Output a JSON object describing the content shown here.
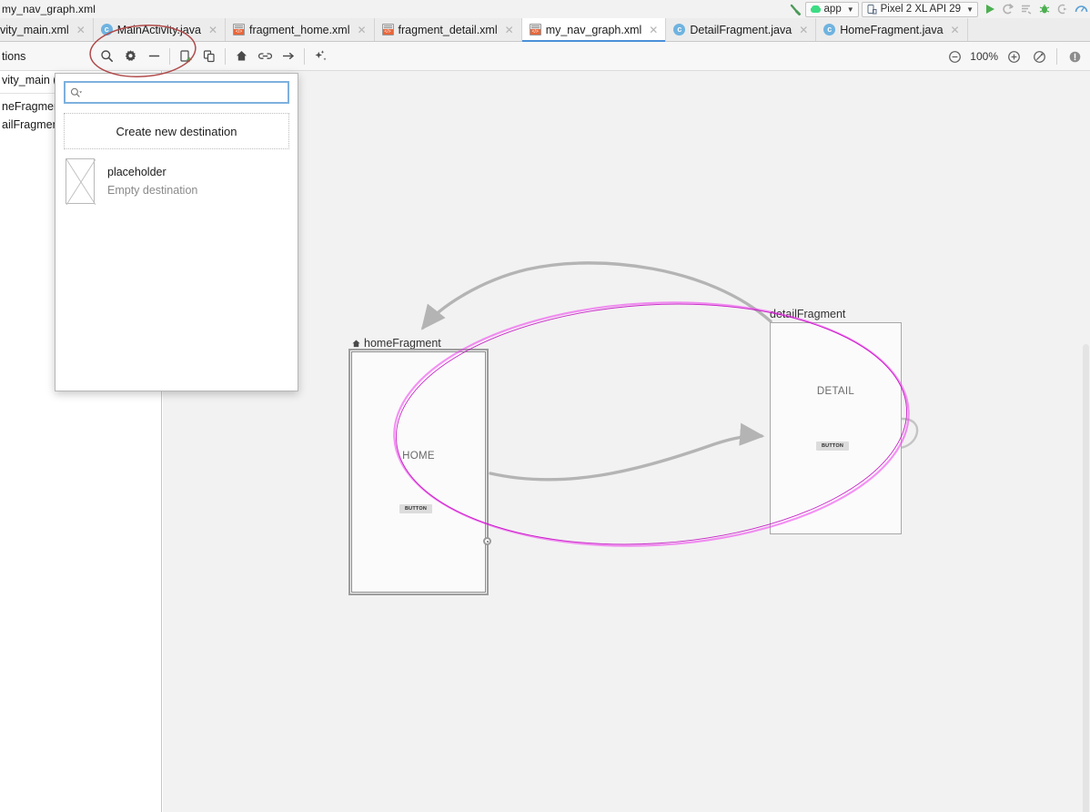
{
  "window": {
    "breadcrumb_title": "my_nav_graph.xml"
  },
  "run_toolbar": {
    "build_icon": "build-hammer-icon",
    "run_config": {
      "label": "app",
      "icon": "android-icon",
      "caret": "▼"
    },
    "device": {
      "label": "Pixel 2 XL API 29",
      "icon": "device-icon",
      "caret": "▼"
    },
    "actions": [
      {
        "name": "run-button",
        "icon": "play-icon",
        "color": "#4caf50"
      },
      {
        "name": "apply-changes-button",
        "icon": "apply-changes-icon",
        "color": "#b0b0b0"
      },
      {
        "name": "apply-code-changes-button",
        "icon": "apply-code-changes-icon",
        "color": "#b0b0b0"
      },
      {
        "name": "debug-button",
        "icon": "debug-bug-icon",
        "color": "#4caf50"
      },
      {
        "name": "attach-debugger-button",
        "icon": "attach-debugger-icon",
        "color": "#b0b0b0"
      },
      {
        "name": "profiler-button",
        "icon": "profiler-icon",
        "color": "#5a9fd4"
      }
    ]
  },
  "tabs": [
    {
      "label": "vity_main.xml",
      "icon": "xml-layout-icon",
      "active": false,
      "clipped": true
    },
    {
      "label": "MainActivity.java",
      "icon": "java-class-icon",
      "active": false
    },
    {
      "label": "fragment_home.xml",
      "icon": "xml-layout-icon",
      "active": false
    },
    {
      "label": "fragment_detail.xml",
      "icon": "xml-layout-icon",
      "active": false
    },
    {
      "label": "my_nav_graph.xml",
      "icon": "xml-layout-icon",
      "active": true
    },
    {
      "label": "DetailFragment.java",
      "icon": "java-class-icon",
      "active": false
    },
    {
      "label": "HomeFragment.java",
      "icon": "java-class-icon",
      "active": false
    }
  ],
  "nav_toolbar": {
    "left_label": "tions",
    "buttons": [
      {
        "name": "search-button",
        "icon": "search-icon",
        "tooltip": "Search"
      },
      {
        "name": "settings-button",
        "icon": "gear-icon",
        "tooltip": "Settings"
      },
      {
        "name": "remove-button",
        "icon": "minus-icon",
        "tooltip": "Remove"
      },
      {
        "name": "new-destination-button",
        "icon": "new-destination-icon",
        "tooltip": "New Destination"
      },
      {
        "name": "nested-graph-button",
        "icon": "nested-graph-icon",
        "tooltip": "Nested Graph"
      },
      {
        "name": "start-destination-button",
        "icon": "home-icon",
        "tooltip": "Assign start destination"
      },
      {
        "name": "action-button",
        "icon": "link-icon",
        "tooltip": "Add action"
      },
      {
        "name": "deeplink-button",
        "icon": "arrow-right-icon",
        "tooltip": "Add deep link"
      },
      {
        "name": "auto-arrange-button",
        "icon": "auto-arrange-icon",
        "tooltip": "Auto arrange"
      }
    ],
    "zoom": {
      "out_icon": "zoom-out-icon",
      "level": "100%",
      "in_icon": "zoom-in-icon",
      "fit_icon": "zoom-to-fit-icon",
      "issues_icon": "issues-icon"
    }
  },
  "component_tree": {
    "rows": [
      {
        "label": "vity_main ("
      },
      {
        "label": "neFragmen"
      },
      {
        "label": "ailFragmen"
      }
    ]
  },
  "popup": {
    "name": "add-destination-popup",
    "search": {
      "placeholder": "",
      "value": "",
      "icon": "search-dropdown-icon"
    },
    "create_new_label": "Create new destination",
    "items": [
      {
        "title": "placeholder",
        "subtitle": "Empty destination",
        "thumb": "empty-destination-thumb"
      }
    ]
  },
  "graph": {
    "nodes": [
      {
        "name": "home-fragment-node",
        "label": "homeFragment",
        "is_start": true,
        "start_icon": "home-icon",
        "center_text": "HOME",
        "button_text": "BUTTON",
        "selected": true
      },
      {
        "name": "detail-fragment-node",
        "label": "detailFragment",
        "is_start": false,
        "center_text": "DETAIL",
        "button_text": "BUTTON",
        "selected": false
      }
    ],
    "actions": [
      {
        "name": "action-detail-to-home",
        "from": "detailFragment",
        "to": "homeFragment"
      },
      {
        "name": "action-home-to-detail",
        "from": "homeFragment",
        "to": "detailFragment"
      },
      {
        "name": "action-detail-self-loop",
        "from": "detailFragment",
        "to": "detailFragment"
      }
    ],
    "annotations": [
      {
        "name": "toolbar-highlight-ellipse",
        "color": "#b04a4a",
        "shape": "ellipse"
      },
      {
        "name": "canvas-highlight-ellipse",
        "color": "#e020e0",
        "shape": "ellipse"
      }
    ]
  }
}
